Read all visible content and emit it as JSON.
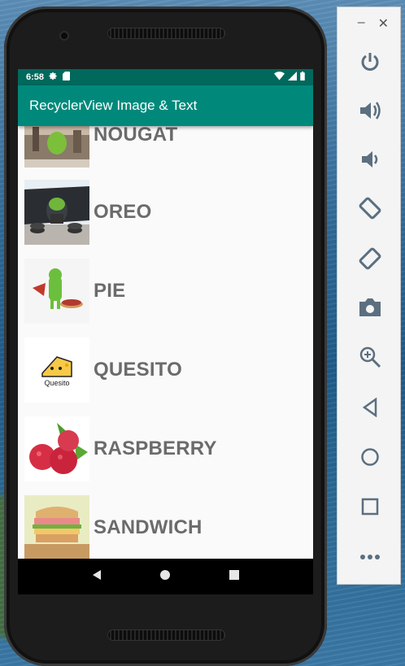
{
  "status_bar": {
    "time": "6:58"
  },
  "app_bar": {
    "title": "RecyclerView Image & Text"
  },
  "list": {
    "items": [
      {
        "label": "NOUGAT"
      },
      {
        "label": "OREO"
      },
      {
        "label": "PIE"
      },
      {
        "label": "QUESITO",
        "logo_text": "Quesito"
      },
      {
        "label": "RASPBERRY"
      },
      {
        "label": "SANDWICH"
      }
    ]
  },
  "emulator_panel": {
    "tools": [
      "power-icon",
      "volume-up-icon",
      "volume-down-icon",
      "rotate-left-icon",
      "rotate-right-icon",
      "camera-icon",
      "zoom-icon",
      "back-icon",
      "home-icon",
      "overview-icon",
      "more-icon"
    ]
  },
  "colors": {
    "status_bar": "#00695c",
    "app_bar": "#00897b",
    "label": "#6b6b6b"
  }
}
